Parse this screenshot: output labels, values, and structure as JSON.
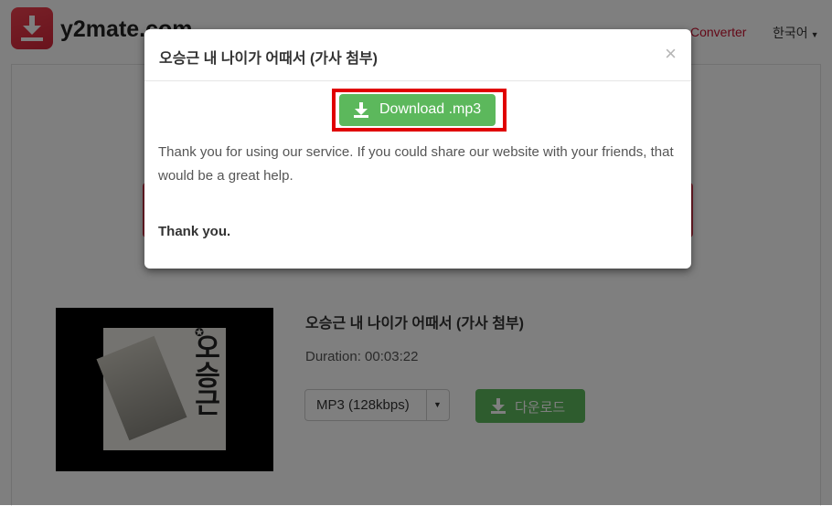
{
  "brand": {
    "name": "y2mate.com",
    "color": "#e33b4f"
  },
  "nav": {
    "converter": "Converter",
    "language": "한국어"
  },
  "video": {
    "title": "오승근 내 나이가 어때서 (가사 첨부)",
    "duration": "Duration: 00:03:22",
    "quality_selected": "MP3 (128kbps)",
    "download_label": "다운로드",
    "cover_text": "오승근"
  },
  "modal": {
    "title": "오승근 내 나이가 어때서 (가사 첨부)",
    "close": "×",
    "download_button": "Download .mp3",
    "message": "Thank you for using our service. If you could share our website with your friends, that would be a great help.",
    "thanks": "Thank you."
  },
  "colors": {
    "accent_green": "#5cb85c",
    "highlight_red": "#e00000",
    "overlay": "rgba(0,0,0,0.5)"
  },
  "icons": [
    "download-arrow-icon",
    "close-icon",
    "chevron-down-icon"
  ]
}
